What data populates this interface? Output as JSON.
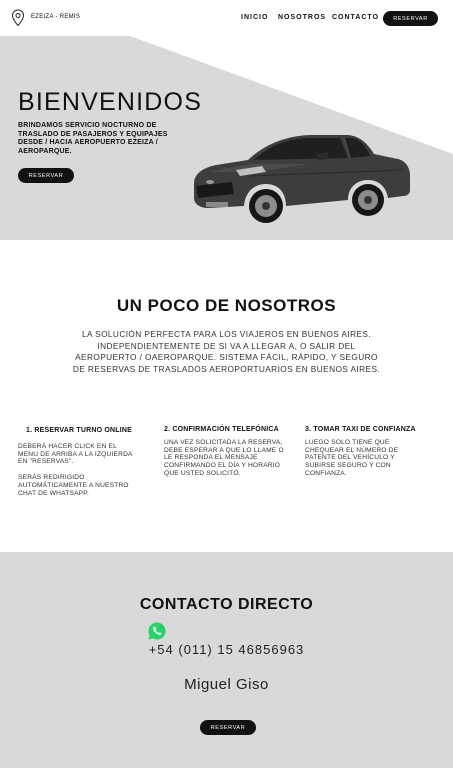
{
  "header": {
    "brand": "EZEIZA - REMIS",
    "logo_icon": "map-pin-icon",
    "nav": {
      "inicio": "INICIO",
      "nosotros": "NOSOTROS",
      "contacto": "CONTACTO"
    },
    "reserve_label": "RESERVAR"
  },
  "hero": {
    "title": "BIENVENIDOS",
    "subtitle": "BRINDAMOS SERVICIO NOCTURNO DE TRASLADO DE PASAJEROS Y EQUIPAJES DESDE / HACIA AEROPUERTO EZEIZA / AEROPARQUE.",
    "reserve_label": "RESERVAR",
    "image": "dark-gray-sedan-car"
  },
  "about": {
    "title": "UN POCO DE NOSOTROS",
    "text": "LA SOLUCIÓN PERFECTA PARA LOS VIAJEROS EN BUENOS AIRES. INDEPENDIENTEMENTE DE SI VA A LLEGAR A, O SALIR DEL AEROPUERTO / OAEROPARQUE. SISTEMA FÁCIL, RÁPIDO, Y SEGURO DE RESERVAS DE TRASLADOS AEROPORTUARIOS EN BUENOS AIRES.",
    "steps": [
      {
        "title": "1. RESERVAR TURNO ONLINE",
        "text": "DEBERÁ HACER CLICK EN EL MENU DE ARRIBA A LA IZQUIERDA EN \"RESERVAS\".",
        "text2": "SERÁS REDIRIGIDO AUTOMÁTICAMENTE A NUESTRO CHAT DE WHATSAPP."
      },
      {
        "title": "2. CONFIRMACIÓN TELEFÓNICA",
        "text": "UNA VEZ SOLICITADA LA RESERVA, DEBE ESPERAR A QUE LO LLAME O LE RESPONDA EL MENSAJE CONFIRMANDO EL DÍA Y HORARIO QUE USTED SOLICITÓ."
      },
      {
        "title": "3. TOMAR TAXI DE CONFIANZA",
        "text": "LUEGO SOLO TIENE QUE CHEQUEAR EL NÚMERO DE PATENTE DEL VEHÍCULO Y SUBIRSE SEGURO Y CON CONFIANZA."
      }
    ]
  },
  "contact": {
    "title": "CONTACTO DIRECTO",
    "icon": "whatsapp-icon",
    "phone": "+54 (011) 15 46856963",
    "name": "Miguel Giso",
    "reserve_label": "RESERVAR"
  },
  "colors": {
    "section_gray": "#d9d9d9",
    "button": "#111111",
    "whatsapp": "#25d366"
  }
}
